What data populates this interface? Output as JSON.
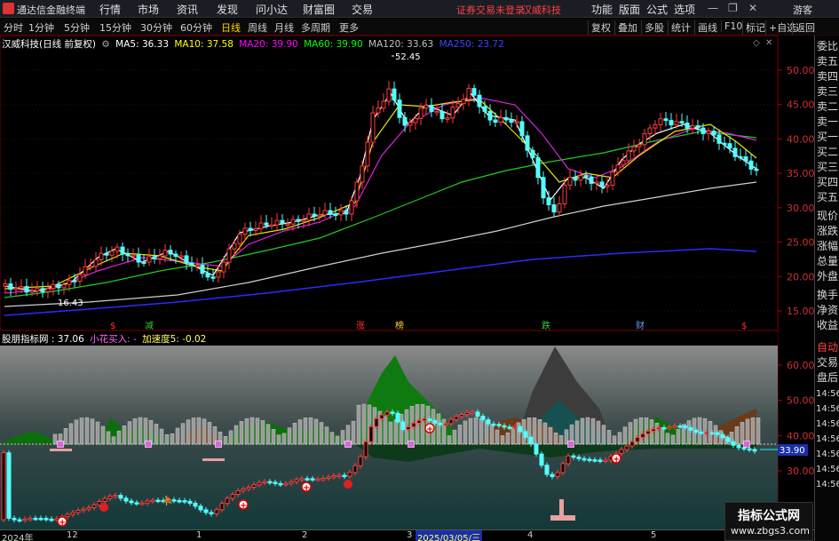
{
  "titlebar": {
    "app_name": "通达信金融终端",
    "menus": [
      "行情",
      "市场",
      "资讯",
      "发现",
      "问小达",
      "财富圈",
      "交易"
    ],
    "login_warning": "证券交易未登录",
    "stock_name": "汉威科技",
    "right_items": [
      "功能",
      "版面",
      "公式",
      "选项"
    ],
    "guest": "游客"
  },
  "toolbar": {
    "periods": [
      "分时",
      "1分钟",
      "5分钟",
      "15分钟",
      "30分钟",
      "60分钟",
      "日线",
      "周线",
      "月线",
      "多周期",
      "更多"
    ],
    "active_period": "日线",
    "buttons": [
      "复权",
      "叠加",
      "多股",
      "统计",
      "画线",
      "F10",
      "标记",
      "+自选",
      "返回"
    ]
  },
  "ma_legend": {
    "title": "汉威科技(日线 前复权)",
    "items": [
      {
        "label": "MA5: 36.33",
        "color": "#ffffff"
      },
      {
        "label": "MA10: 37.58",
        "color": "#ffff00"
      },
      {
        "label": "MA20: 39.90",
        "color": "#ff00ff"
      },
      {
        "label": "MA60: 39.90",
        "color": "#00ff00"
      },
      {
        "label": "MA120: 33.63",
        "color": "#c0c0c0"
      },
      {
        "label": "MA250: 23.72",
        "color": "#4040ff"
      }
    ]
  },
  "indicator_legend": {
    "title": "股朋指标网 : 37.06",
    "item1": "小花买入: -",
    "item2": "加速度5: -0.02"
  },
  "price_axis": [
    "50.00",
    "45.00",
    "40.00",
    "35.00",
    "30.00",
    "25.00",
    "20.00",
    "15.00"
  ],
  "indicator_axis": [
    "60.00",
    "50.00",
    "40.00",
    "30.00"
  ],
  "indicator_value_tag": "33.90",
  "price_annotations": {
    "high": "52.45",
    "low": "16.43"
  },
  "event_markers": [
    {
      "text": "$",
      "color": "#ff3333"
    },
    {
      "text": "减",
      "color": "#33cc33"
    },
    {
      "text": "涨",
      "color": "#ff3333"
    },
    {
      "text": "榜",
      "color": "#ffcc33"
    },
    {
      "text": "跌",
      "color": "#33cc33"
    },
    {
      "text": "财",
      "color": "#6699ff"
    },
    {
      "text": "$",
      "color": "#ff3333"
    }
  ],
  "sidebar": {
    "items": [
      "委比",
      "卖五",
      "卖四",
      "卖三",
      "卖二",
      "卖一",
      "买一",
      "买二",
      "买三",
      "买四",
      "买五",
      "现价",
      "涨跌",
      "涨幅",
      "总量",
      "外盘",
      "换手",
      "净资",
      "收益"
    ],
    "auto_label": "自动",
    "trade_label": "交易",
    "after_label": "盘后",
    "times": [
      "14:56",
      "14:56",
      "14:56",
      "14:56",
      "14:56",
      "14:56",
      "14:56"
    ]
  },
  "xaxis": {
    "labels": [
      "2024年",
      "12",
      "1",
      "2",
      "3",
      "4",
      "5"
    ],
    "cursor_date": "2025/03/05/三"
  },
  "watermark": {
    "line1": "指标公式网",
    "line2": "www.zbgs3.com"
  }
}
